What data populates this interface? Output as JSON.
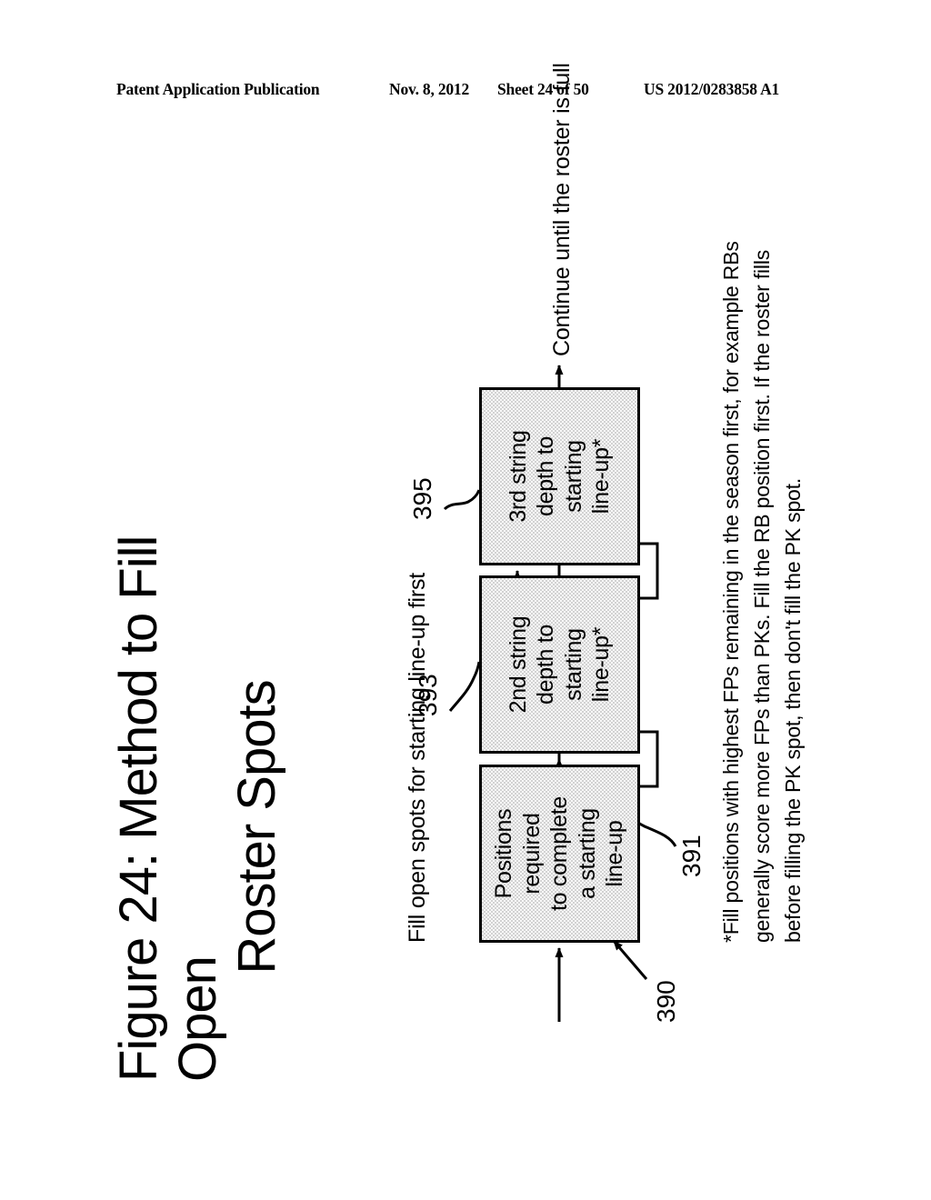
{
  "header": {
    "publication": "Patent Application Publication",
    "date": "Nov. 8, 2012",
    "sheet": "Sheet 24 of 50",
    "patent_number": "US 2012/0283858 A1"
  },
  "figure": {
    "title_line1": "Figure 24: Method to Fill Open",
    "title_line2": "Roster Spots",
    "entry_note": "Fill open spots for starting line-up first",
    "exit_note": "Continue until the roster is full",
    "boxes": [
      {
        "ref": "391",
        "lines": [
          "Positions",
          "required",
          "to complete",
          "a starting",
          "line-up"
        ]
      },
      {
        "ref": "393",
        "lines": [
          "2nd string",
          "depth to",
          "starting",
          "line-up*"
        ]
      },
      {
        "ref": "395",
        "lines": [
          "3rd string",
          "depth to",
          "starting",
          "line-up*"
        ]
      }
    ],
    "diagram_ref": "390",
    "footnote": [
      "*Fill positions with highest FPs remaining in the season first, for example RBs",
      "generally score more FPs than PKs.  Fill the RB position first.  If the roster fills",
      "before filling the PK spot, then don't fill the PK spot."
    ],
    "colors": {
      "box_fill": "#d2d2d2",
      "stroke": "#000000",
      "page": "#ffffff"
    }
  }
}
